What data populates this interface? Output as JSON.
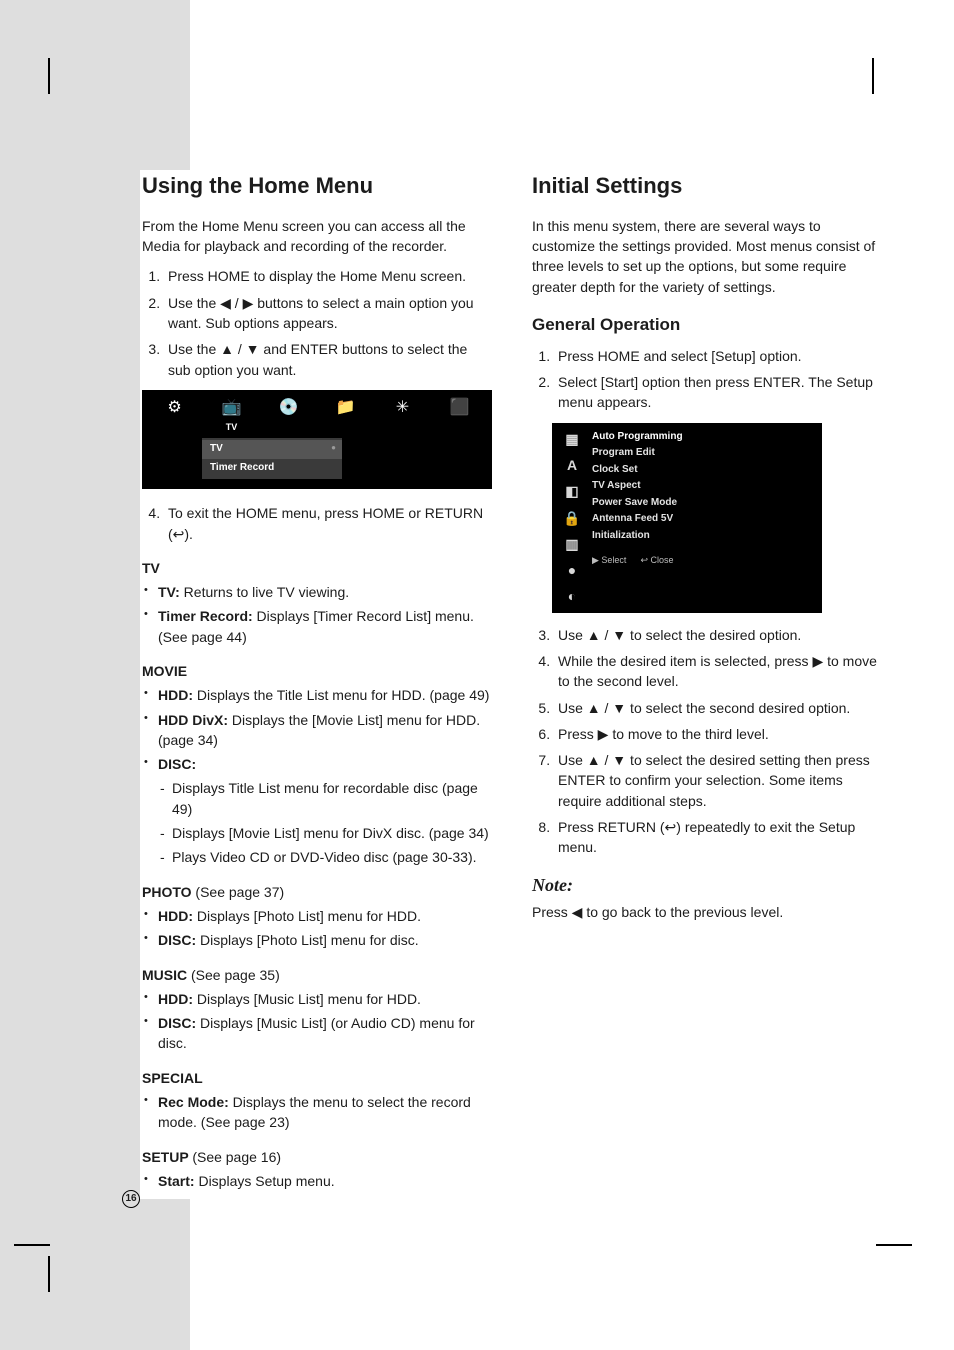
{
  "page_number": "16",
  "left": {
    "heading": "Using the Home Menu",
    "intro": "From the Home Menu screen you can access all the Media for playback and recording of the recorder.",
    "steps": [
      "Press HOME to display the Home Menu screen.",
      "Use the ◀ / ▶ buttons to select a main option you want. Sub options appears.",
      "Use the ▲ / ▼ and ENTER buttons to select the sub option you want."
    ],
    "home_bar": {
      "icons": [
        {
          "glyph": "⚙",
          "label": ""
        },
        {
          "glyph": "📺",
          "label": "TV"
        },
        {
          "glyph": "💿",
          "label": ""
        },
        {
          "glyph": "📁",
          "label": ""
        },
        {
          "glyph": "✳",
          "label": ""
        },
        {
          "glyph": "⬛",
          "label": ""
        }
      ],
      "dropdown": [
        "TV",
        "Timer Record"
      ]
    },
    "step4": "To exit the HOME menu, press HOME or RETURN (↩).",
    "groups": [
      {
        "title": "TV",
        "ref": "",
        "items": [
          {
            "label": "TV:",
            "text": "Returns to live TV viewing."
          },
          {
            "label": "Timer Record:",
            "text": "Displays [Timer Record List] menu. (See page 44)"
          }
        ]
      },
      {
        "title": "MOVIE",
        "ref": "",
        "items": [
          {
            "label": "HDD:",
            "text": "Displays the Title List menu for HDD. (page 49)"
          },
          {
            "label": "HDD DivX:",
            "text": "Displays the [Movie List] menu for HDD. (page 34)"
          },
          {
            "label": "DISC:",
            "text": "",
            "sub": [
              "Displays Title List menu for recordable disc (page 49)",
              "Displays [Movie List] menu for DivX disc. (page 34)",
              "Plays Video CD or DVD-Video disc (page 30-33)."
            ]
          }
        ]
      },
      {
        "title": "PHOTO",
        "ref": "(See page 37)",
        "items": [
          {
            "label": "HDD:",
            "text": "Displays [Photo List] menu for HDD."
          },
          {
            "label": "DISC:",
            "text": "Displays [Photo List] menu for disc."
          }
        ]
      },
      {
        "title": "MUSIC",
        "ref": "(See page 35)",
        "items": [
          {
            "label": "HDD:",
            "text": "Displays [Music List] menu for HDD."
          },
          {
            "label": "DISC:",
            "text": "Displays [Music List] (or Audio CD) menu for disc."
          }
        ]
      },
      {
        "title": "SPECIAL",
        "ref": "",
        "items": [
          {
            "label": "Rec Mode:",
            "text": "Displays the menu to select the record mode. (See page 23)"
          }
        ]
      },
      {
        "title": "SETUP",
        "ref": "(See page 16)",
        "items": [
          {
            "label": "Start:",
            "text": "Displays Setup menu."
          }
        ]
      }
    ]
  },
  "right": {
    "heading": "Initial Settings",
    "intro": "In this menu system, there are several ways to customize the settings provided. Most menus consist of three levels to set up the options, but some require greater depth for the variety of settings.",
    "subheading": "General Operation",
    "steps_a": [
      "Press HOME and select [Setup] option.",
      "Select [Start] option then press ENTER. The Setup menu appears."
    ],
    "setup_fig": {
      "side_icons": [
        "▦",
        "A",
        "◧",
        "🔒",
        "▥",
        "●",
        "◐"
      ],
      "rows": [
        "Auto Programming",
        "Program Edit",
        "Clock Set",
        "TV Aspect",
        "Power Save Mode",
        "Antenna Feed 5V",
        "Initialization"
      ],
      "footer": [
        "▶ Select",
        "↩ Close"
      ]
    },
    "steps_b": [
      "Use ▲ / ▼ to select the desired option.",
      "While the desired item is selected, press ▶ to move to the second level.",
      "Use ▲ / ▼ to select the second desired option.",
      "Press ▶ to move to the third level.",
      "Use ▲ / ▼ to select the desired setting then press ENTER to confirm your selection. Some items require additional steps.",
      "Press RETURN (↩) repeatedly to exit the Setup menu."
    ],
    "note_heading": "Note:",
    "note_text": "Press ◀ to go back to the previous level."
  }
}
